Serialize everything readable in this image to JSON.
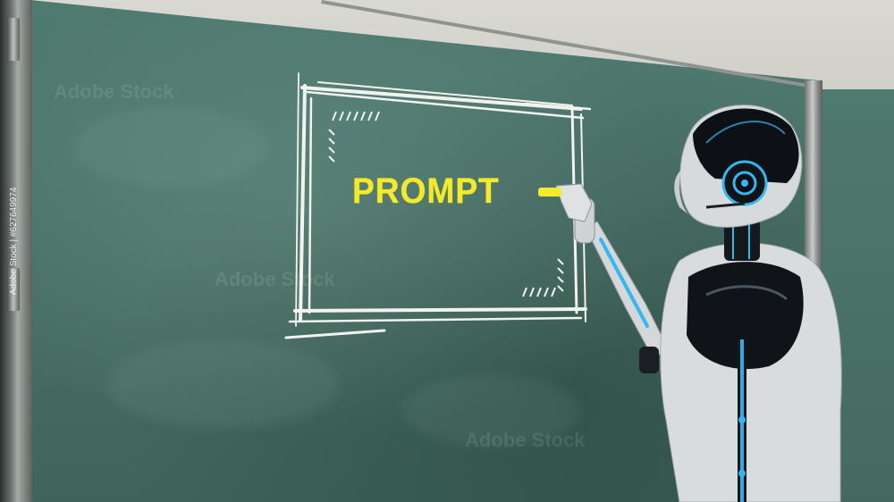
{
  "board_text": "PROMPT",
  "side_watermark": "Adobe Stock | #627649974",
  "stock_watermark": "Adobe Stock",
  "colors": {
    "chalkboard": "#4a7167",
    "chalk_white": "#f2f2ee",
    "marker_yellow": "#f2ea2a",
    "robot_shell": "#d9dcdc",
    "robot_accent": "#35b7f2"
  }
}
